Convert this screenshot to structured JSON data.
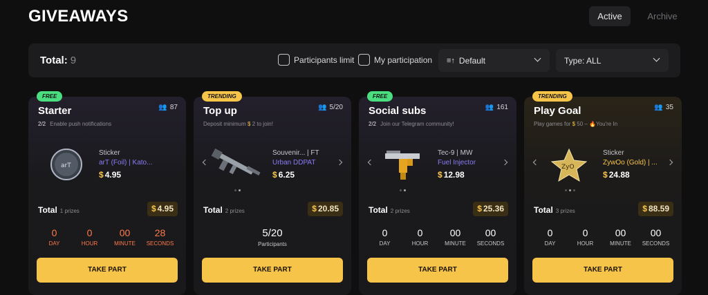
{
  "page": {
    "title": "GIVEAWAYS"
  },
  "tabs": [
    {
      "label": "Active",
      "active": true
    },
    {
      "label": "Archive",
      "active": false
    }
  ],
  "filters": {
    "total_label": "Total:",
    "total_value": "9",
    "participants_limit_label": "Participants limit",
    "my_participation_label": "My participation",
    "sort_value": "Default",
    "type_value": "Type: ALL"
  },
  "colors": {
    "accent": "#f7c44a",
    "free_badge": "#4ade80",
    "countdown_alert": "#ff7a4a",
    "prize_name": "#8b7cf6"
  },
  "cards": [
    {
      "badge": "FREE",
      "title": "Starter",
      "participants": "87",
      "subtitle_strong": "2/2",
      "subtitle": "Enable push notifications",
      "prize_type": "Sticker",
      "prize_name": "arT (Foil) | Kato...",
      "prize_price": "4.95",
      "total_label": "Total",
      "prizes_label": "1 prizes",
      "total_value": "4.95",
      "countdown": [
        {
          "value": "0",
          "label": "DAY"
        },
        {
          "value": "0",
          "label": "HOUR"
        },
        {
          "value": "00",
          "label": "MINUTE"
        },
        {
          "value": "28",
          "label": "SECONDS"
        }
      ],
      "button": "TAKE PART"
    },
    {
      "badge": "TRENDING",
      "title": "Top up",
      "participants": "5/20",
      "subtitle_pre": "Deposit minimum",
      "subtitle_amount": "$",
      "subtitle_post": "2 to join!",
      "prize_type": "Souvenir... | FT",
      "prize_name": "Urban DDPAT",
      "prize_price": "6.25",
      "total_label": "Total",
      "prizes_label": "2 prizes",
      "total_value": "20.85",
      "limit_value": "5/20",
      "limit_label": "Participants",
      "button": "TAKE PART"
    },
    {
      "badge": "FREE",
      "title": "Social subs",
      "participants": "161",
      "subtitle_strong": "2/2",
      "subtitle": "Join our Telegram community!",
      "prize_type": "Tec-9 | MW",
      "prize_name": "Fuel Injector",
      "prize_price": "12.98",
      "total_label": "Total",
      "prizes_label": "2 prizes",
      "total_value": "25.36",
      "countdown": [
        {
          "value": "0",
          "label": "DAY"
        },
        {
          "value": "0",
          "label": "HOUR"
        },
        {
          "value": "00",
          "label": "MINUTE"
        },
        {
          "value": "00",
          "label": "SECONDS"
        }
      ],
      "button": "TAKE PART"
    },
    {
      "badge": "TRENDING",
      "title": "Play Goal",
      "participants": "35",
      "subtitle_pre": "Play games for",
      "subtitle_amount": "$",
      "subtitle_post": "50 – 🔥You're In",
      "prize_type": "Sticker",
      "prize_name": "ZywOo (Gold) | ...",
      "prize_price": "24.88",
      "total_label": "Total",
      "prizes_label": "3 prizes",
      "total_value": "88.59",
      "countdown": [
        {
          "value": "0",
          "label": "DAY"
        },
        {
          "value": "0",
          "label": "HOUR"
        },
        {
          "value": "00",
          "label": "MINUTE"
        },
        {
          "value": "00",
          "label": "SECONDS"
        }
      ],
      "button": "TAKE PART"
    }
  ]
}
